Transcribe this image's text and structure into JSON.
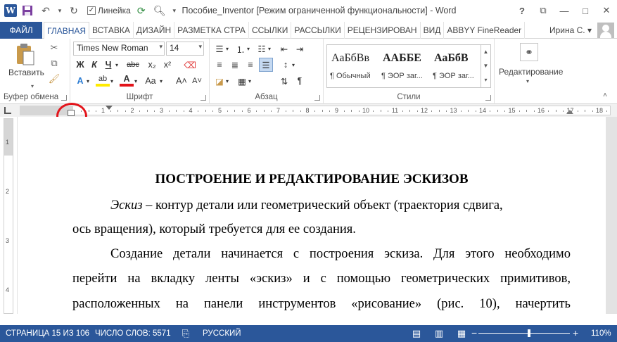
{
  "titlebar": {
    "doc_title": "Пособие_Inventor [Режим ограниченной функциональности] - Word",
    "ruler_checkbox_label": "Линейка",
    "ruler_checked": "✓",
    "help": "?",
    "ribbon_display": "⧉",
    "minimize": "—",
    "maximize": "□",
    "close": "✕"
  },
  "tabs": {
    "file": "ФАЙЛ",
    "items": [
      "ГЛАВНАЯ",
      "ВСТАВКА",
      "ДИЗАЙН",
      "РАЗМЕТКА СТРА",
      "ССЫЛКИ",
      "РАССЫЛКИ",
      "РЕЦЕНЗИРОВАН",
      "ВИД",
      "ABBYY FineReader"
    ],
    "active_index": 0,
    "user": "Ирина С. ▾"
  },
  "ribbon": {
    "clipboard": {
      "paste_label": "Вставить",
      "group_label": "Буфер обмена"
    },
    "font": {
      "font_name": "Times New Roman",
      "font_size": "14",
      "bold": "Ж",
      "italic": "К",
      "underline": "Ч",
      "strike": "abc",
      "subscript": "x₂",
      "superscript": "x²",
      "grow": "A˄",
      "shrink": "A˅",
      "case": "Aa",
      "group_label": "Шрифт"
    },
    "paragraph": {
      "group_label": "Абзац",
      "pilcrow": "¶"
    },
    "styles": {
      "items": [
        {
          "sample": "АаБбВв",
          "name": "¶ Обычный"
        },
        {
          "sample": "ААББЕ",
          "name": "¶ ЭОР заг..."
        },
        {
          "sample": "АаБбВ",
          "name": "¶ ЭОР заг..."
        }
      ],
      "group_label": "Стили"
    },
    "editing": {
      "label": "Редактирование"
    }
  },
  "ruler": {
    "numbers": [
      "1",
      "1",
      "2",
      "3",
      "4",
      "5",
      "6",
      "7",
      "8",
      "9",
      "10",
      "11",
      "12",
      "13",
      "14",
      "15",
      "16",
      "17",
      "18"
    ],
    "vnumbers": [
      "1",
      "2",
      "3",
      "4"
    ]
  },
  "document": {
    "heading": "ПОСТРОЕНИЕ И РЕДАКТИРОВАНИЕ ЭСКИЗОВ",
    "p1_italic": "Эскиз",
    "p1_line1": "– контур детали или геометрический объект (траектория сдвига,",
    "p1_line2": "ось вращения), который требуется для ее создания.",
    "p2_line1": "Создание детали начинается с построения эскиза. Для этого необходимо",
    "p2_line2": "перейти на вкладку ленты «эскиз» и с помощью геометрических примитивов,",
    "p2_line3": "расположенных на панели инструментов «рисование» (рис. 10), начертить"
  },
  "statusbar": {
    "page": "СТРАНИЦА 15 ИЗ 106",
    "words": "ЧИСЛО СЛОВ: 5571",
    "language": "РУССКИЙ",
    "zoom_minus": "−",
    "zoom_plus": "+",
    "zoom": "110%"
  }
}
